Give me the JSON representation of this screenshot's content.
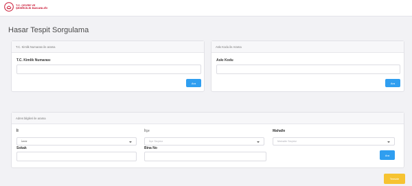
{
  "header": {
    "logo_line1": "T.C. ÇEVRE VE",
    "logo_line2": "ŞEHİRCİLİK BAKANLIĞI"
  },
  "page": {
    "title": "Hasar Tespit Sorgulama"
  },
  "tc_search": {
    "header": "T.C. Kimlik Numarası ile arama",
    "label": "T.C. Kimlik Numarası",
    "value": "",
    "button": "Ara"
  },
  "aski_search": {
    "header": "Askı Kodu ile Arama",
    "label": "Askı Kodu",
    "value": "",
    "button": "Ara"
  },
  "address_search": {
    "header": "Adres bilgileri ile arama",
    "il_label": "İl",
    "il_value": "İzmir",
    "ilce_label": "İlçe",
    "ilce_placeholder": "İlçe Seçiniz",
    "mahalle_label": "Mahalle",
    "mahalle_placeholder": "Mahalle Seçiniz",
    "sokak_label": "Sokak",
    "sokak_value": "",
    "bina_label": "Bina No",
    "bina_value": "",
    "button": "Ara"
  },
  "footer": {
    "clear_button": "Temizle"
  },
  "colors": {
    "primary_button": "#2f9ef0",
    "clear_button": "#f6c331",
    "brand_red": "#c8102e"
  }
}
